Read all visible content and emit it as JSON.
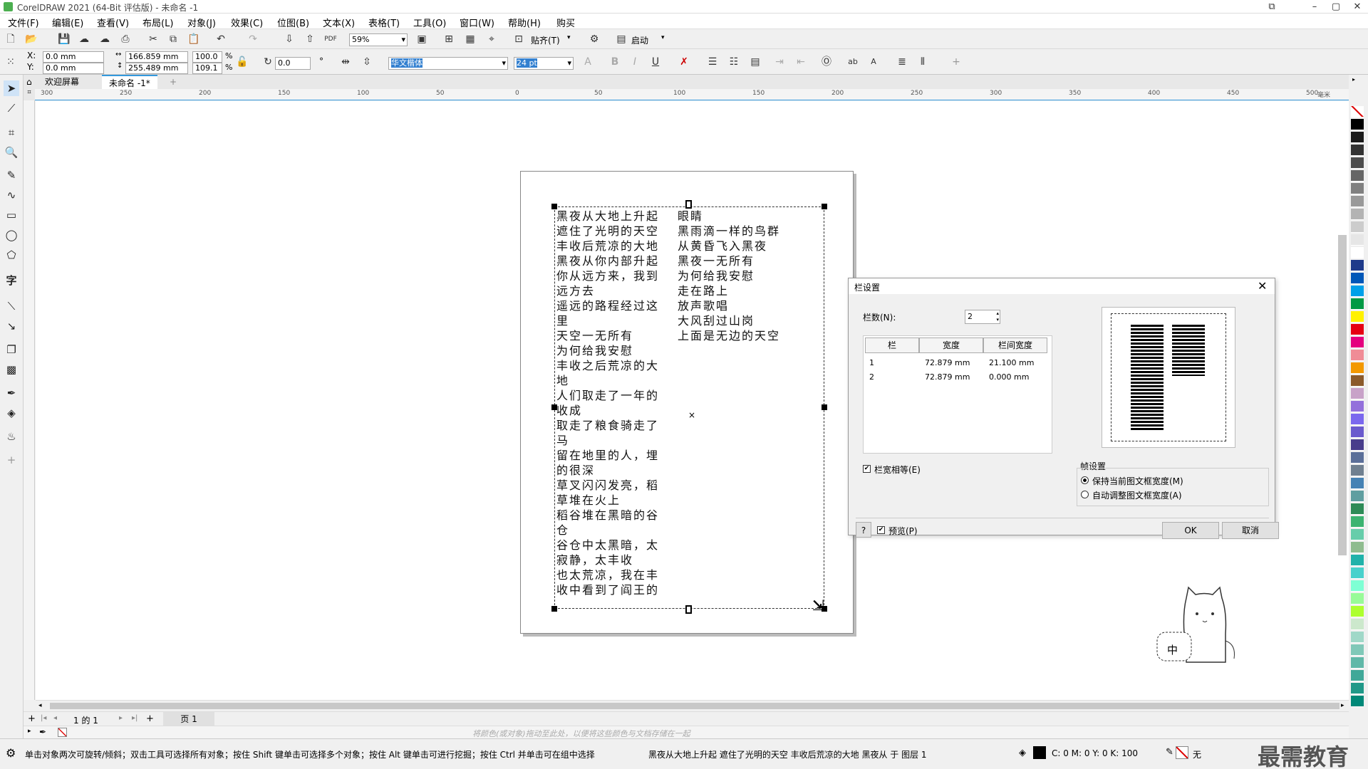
{
  "title_bar": {
    "title": "CorelDRAW 2021 (64-Bit 评估版) - 未命名 -1"
  },
  "menu": [
    "文件(F)",
    "编辑(E)",
    "查看(V)",
    "布局(L)",
    "对象(J)",
    "效果(C)",
    "位图(B)",
    "文本(X)",
    "表格(T)",
    "工具(O)",
    "窗口(W)",
    "帮助(H)",
    "购买"
  ],
  "standard_toolbar": {
    "zoom": "59%",
    "snap_label": "贴齐(T)",
    "launch_label": "启动"
  },
  "property_bar": {
    "x": "0.0 mm",
    "y": "0.0 mm",
    "width": "166.859 mm",
    "height": "255.489 mm",
    "scale_w": "100.0",
    "scale_h": "109.1",
    "percent": "%",
    "rotation": "0.0",
    "font_name": "华文楷体",
    "font_size": "24 pt",
    "x_label": "X:",
    "y_label": "Y:"
  },
  "tabs": {
    "welcome": "欢迎屏幕",
    "document": "未命名 -1*"
  },
  "ruler_labels": [
    "300",
    "250",
    "200",
    "150",
    "100",
    "50",
    "0",
    "50",
    "100",
    "150",
    "200",
    "250",
    "300",
    "350",
    "400",
    "450",
    "500",
    "毫米"
  ],
  "poem": {
    "col1": [
      "黑夜从大地上升起",
      "遮住了光明的天空",
      "丰收后荒凉的大地",
      "黑夜从你内部升起",
      "你从远方来，我到",
      "远方去",
      "遥远的路程经过这",
      "里",
      "天空一无所有",
      "为何给我安慰",
      "丰收之后荒凉的大",
      "地",
      "人们取走了一年的",
      "收成",
      "取走了粮食骑走了",
      "马",
      "留在地里的人，埋",
      "的很深",
      "草叉闪闪发亮，稻",
      "草堆在火上",
      "稻谷堆在黑暗的谷",
      "仓",
      "谷仓中太黑暗，太",
      "寂静，太丰收",
      "也太荒凉，我在丰",
      "收中看到了阎王的"
    ],
    "col2": [
      "眼睛",
      "黑雨滴一样的鸟群",
      "从黄昏飞入黑夜",
      "黑夜一无所有",
      "为何给我安慰",
      "走在路上",
      "放声歌唱",
      "大风刮过山岗",
      "上面是无边的天空"
    ]
  },
  "dialog": {
    "title": "栏设置",
    "columns_label": "栏数(N):",
    "columns_value": "2",
    "table_headers": [
      "栏",
      "宽度",
      "栏间宽度"
    ],
    "table_rows": [
      {
        "col": "1",
        "width": "72.879 mm",
        "gutter": "21.100 mm"
      },
      {
        "col": "2",
        "width": "72.879 mm",
        "gutter": "0.000 mm"
      }
    ],
    "equal_width_label": "栏宽相等(E)",
    "frame_settings_label": "帧设置",
    "keep_width_label": "保持当前图文框宽度(M)",
    "auto_width_label": "自动调整图文框宽度(A)",
    "help_label": "?",
    "preview_label": "预览(P)",
    "ok_label": "OK",
    "cancel_label": "取消"
  },
  "page_bar": {
    "page_count": "1 的 1",
    "page_tab": "页 1"
  },
  "color_bar_hint": "将颜色(或对象)拖动至此处，以便将这些颜色与文档存储在一起",
  "status": {
    "hint": "单击对象两次可旋转/倾斜；双击工具可选择所有对象；按住 Shift 键单击可选择多个对象；按住 Alt 键单击可进行挖掘；按住 Ctrl 并单击可在组中选择",
    "object_info": "黑夜从大地上升起 遮住了光明的天空 丰收后荒凉的大地 黑夜从 于 图层 1",
    "fill_color": "C: 0 M: 0 Y: 0 K: 100",
    "outline": "无"
  },
  "watermark": "最需教育",
  "mascot_text": "中",
  "palette_colors": [
    "#ffffff",
    "#000000",
    "#1a1a1a",
    "#333333",
    "#4d4d4d",
    "#666666",
    "#808080",
    "#999999",
    "#b3b3b3",
    "#cccccc",
    "#e6e6e6",
    "#ffffff",
    "#1e3a8a",
    "#0057b8",
    "#00a0e9",
    "#009944",
    "#fff100",
    "#e60012",
    "#e4007f",
    "#f08c96",
    "#f39800",
    "#8b5a2b",
    "#c8a2c8",
    "#9370db",
    "#7b68ee",
    "#6a5acd",
    "#483d8b",
    "#5b6f99",
    "#708090",
    "#4682b4",
    "#5f9ea0",
    "#2e8b57",
    "#3cb371",
    "#66cdaa",
    "#8fbc8f",
    "#20b2aa",
    "#48d1cc",
    "#7fffd4",
    "#98fb98",
    "#adff2f",
    "#cce8cc",
    "#a0d8c8",
    "#80c8b8",
    "#60b8a8",
    "#40a898",
    "#209888",
    "#008878"
  ]
}
